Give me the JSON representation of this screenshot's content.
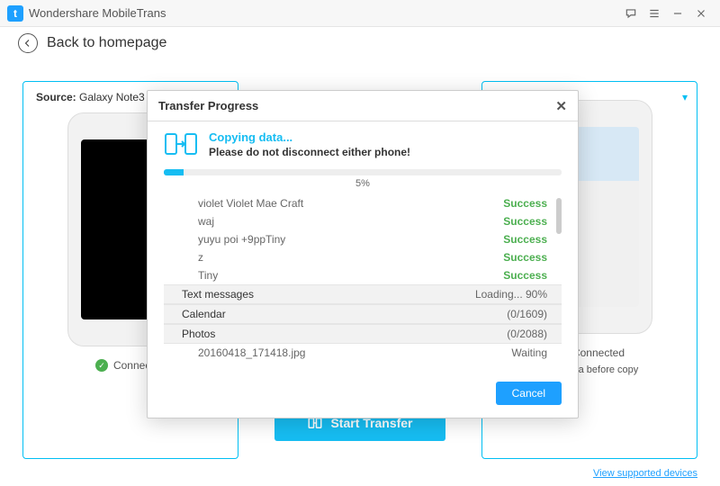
{
  "app": {
    "title": "Wondershare MobileTrans",
    "logo_letter": "t"
  },
  "back": {
    "label": "Back to homepage"
  },
  "source": {
    "label": "Source:",
    "device": "Galaxy Note3",
    "status": "Connected"
  },
  "dest": {
    "status": "Connected",
    "clear_label": "Clear data before copy"
  },
  "center": {
    "start_label": "Start Transfer"
  },
  "footer": {
    "supported": "View supported devices"
  },
  "modal": {
    "title": "Transfer Progress",
    "copying": "Copying data...",
    "warning": "Please do not disconnect either phone!",
    "percent_text": "5%",
    "percent_value": 5,
    "cancel": "Cancel",
    "contacts": [
      {
        "name": "violet Violet Mae Craft",
        "status": "Success"
      },
      {
        "name": "waj",
        "status": "Success"
      },
      {
        "name": "yuyu poi +9ppTiny",
        "status": "Success"
      },
      {
        "name": "z",
        "status": "Success"
      },
      {
        "name": "Tiny",
        "status": "Success"
      }
    ],
    "categories": [
      {
        "label": "Text messages",
        "status": "Loading... 90%"
      },
      {
        "label": "Calendar",
        "status": "(0/1609)"
      },
      {
        "label": "Photos",
        "status": "(0/2088)"
      }
    ],
    "photo_item": {
      "name": "20160418_171418.jpg",
      "status": "Waiting"
    }
  }
}
